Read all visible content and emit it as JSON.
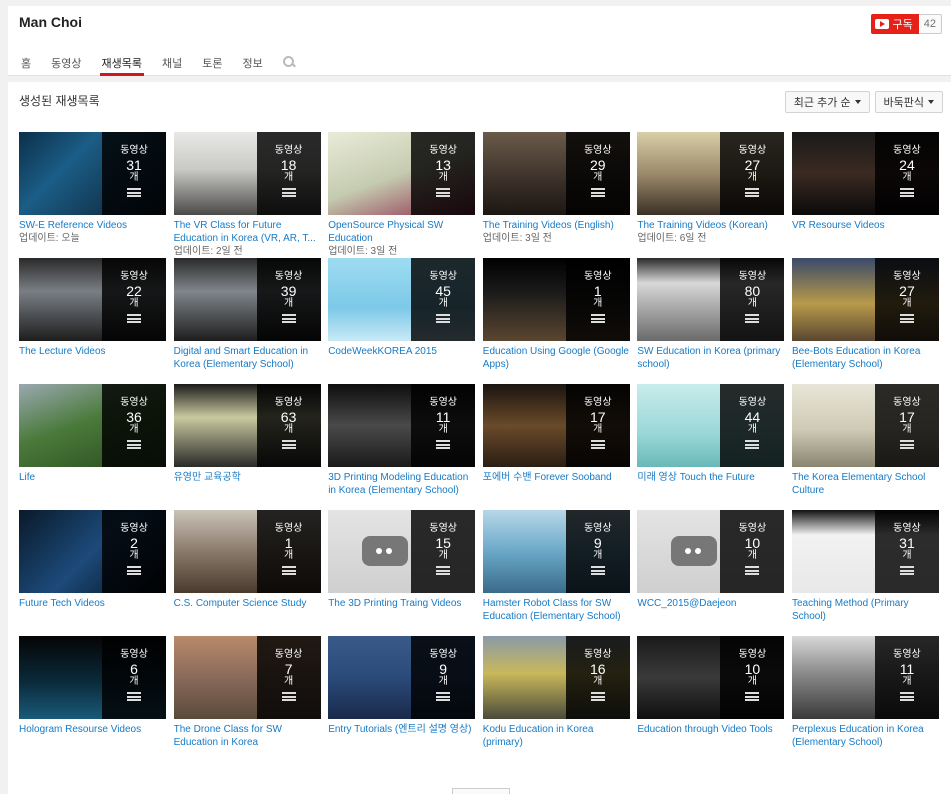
{
  "channel": {
    "name": "Man Choi",
    "subscribe_label": "구독",
    "subscriber_count": "42"
  },
  "tabs": [
    {
      "label": "홈",
      "active": false
    },
    {
      "label": "동영상",
      "active": false
    },
    {
      "label": "재생목록",
      "active": true
    },
    {
      "label": "채널",
      "active": false
    },
    {
      "label": "토론",
      "active": false
    },
    {
      "label": "정보",
      "active": false
    }
  ],
  "section": {
    "title": "생성된 재생목록",
    "sort_label": "최근 추가 순",
    "view_label": "바둑판식"
  },
  "overlay": {
    "label": "동영상",
    "unit": "개"
  },
  "playlists": [
    {
      "title": "SW-E Reference Videos",
      "meta": "업데이트: 오늘",
      "count": "31",
      "bg": "linear-gradient(135deg,#0c2f4a 0%,#1b5d86 35%,#0b1a2a 100%)"
    },
    {
      "title": "The VR Class for Future Education in Korea (VR, AR, T...",
      "meta": "업데이트: 2일 전",
      "count": "18",
      "bg": "linear-gradient(180deg,#e8e8e6 0%,#c9c9c6 45%,#4b4a48 100%)"
    },
    {
      "title": "OpenSource Physical SW Education",
      "meta": "업데이트: 3일 전",
      "count": "13",
      "bg": "linear-gradient(160deg,#e9ecd8 0%,#c5cbb0 50%,#8c2a4a 100%)"
    },
    {
      "title": "The Training Videos (English)",
      "meta": "업데이트: 3일 전",
      "count": "29",
      "bg": "linear-gradient(180deg,#6a5b4a 0%,#3a2f28 60%,#1c1612 100%)"
    },
    {
      "title": "The Training Videos (Korean)",
      "meta": "업데이트: 6일 전",
      "count": "27",
      "bg": "linear-gradient(180deg,#d8cfa8 0%,#9c8a6a 50%,#3a3026 100%)"
    },
    {
      "title": "VR Resourse Videos",
      "meta": "",
      "count": "24",
      "bg": "linear-gradient(180deg,#1a1a1a 0%,#3b2a22 50%,#0a0a0a 100%)"
    },
    {
      "title": "The Lecture Videos",
      "meta": "",
      "count": "22",
      "bg": "linear-gradient(180deg,#2a2a2a 0%,#7a7f85 40%,#1d1d1d 100%)"
    },
    {
      "title": "Digital and Smart Education in Korea (Elementary School)",
      "meta": "",
      "count": "39",
      "bg": "linear-gradient(180deg,#2a2a2a 0%,#80868b 40%,#1d1d1d 100%)"
    },
    {
      "title": "CodeWeekKOREA 2015",
      "meta": "",
      "count": "45",
      "bg": "linear-gradient(180deg,#9fdcf2 0%,#7cc9e8 60%,#c9e9f5 100%)"
    },
    {
      "title": "Education Using Google (Google Apps)",
      "meta": "",
      "count": "1",
      "bg": "linear-gradient(180deg,#000 0%,#1a1a1a 40%,#5a4630 100%)"
    },
    {
      "title": "SW Education in Korea (primary school)",
      "meta": "",
      "count": "80",
      "bg": "linear-gradient(180deg,#2a2a2a 0%,#d8d8d8 30%,#6a6a6a 100%)"
    },
    {
      "title": "Bee-Bots Education in Korea (Elementary School)",
      "meta": "",
      "count": "27",
      "bg": "linear-gradient(180deg,#3a4a6a 0%,#b89a4a 55%,#5a4630 100%)"
    },
    {
      "title": "Life",
      "meta": "",
      "count": "36",
      "bg": "linear-gradient(160deg,#9aa8b0 0%,#4a7a3a 45%,#2a4a1e 100%)"
    },
    {
      "title": "유영만 교육공학",
      "meta": "",
      "count": "63",
      "bg": "linear-gradient(180deg,#1a1a1a 0%,#c9c9a0 40%,#2a2a2a 100%)"
    },
    {
      "title": "3D Printing Modeling Education in Korea (Elementary School)",
      "meta": "",
      "count": "11",
      "bg": "linear-gradient(180deg,#0d0d0d 0%,#4a4a4a 50%,#1a1a1a 100%)"
    },
    {
      "title": "포에버 수밴 Forever Sooband",
      "meta": "",
      "count": "17",
      "bg": "linear-gradient(180deg,#1a1410 0%,#6a4a2a 50%,#2a1e14 100%)"
    },
    {
      "title": "미래 영상 Touch the Future",
      "meta": "",
      "count": "44",
      "bg": "linear-gradient(180deg,#c9ecec 0%,#9ad7d7 60%,#6ab8b8 100%)"
    },
    {
      "title": "The Korea Elementary School Culture",
      "meta": "",
      "count": "17",
      "bg": "linear-gradient(180deg,#e8e6d8 0%,#cfcab5 55%,#8a8570 100%)"
    },
    {
      "title": "Future Tech Videos",
      "meta": "",
      "count": "2",
      "bg": "linear-gradient(135deg,#0a1a2a 0%,#1c4a7a 50%,#050b14 100%)"
    },
    {
      "title": "C.S. Computer Science Study",
      "meta": "",
      "count": "1",
      "bg": "linear-gradient(180deg,#c9c3b8 0%,#8a7a6a 50%,#4a3a2e 100%)"
    },
    {
      "title": "The 3D Printing Traing Videos",
      "meta": "",
      "count": "15",
      "bg": "linear-gradient(180deg,#e4e4e4 0%,#cfcfcf 100%)",
      "placeholder": true
    },
    {
      "title": "Hamster Robot Class for SW Education (Elementary School)",
      "meta": "",
      "count": "9",
      "bg": "linear-gradient(180deg,#b7d7e8 0%,#6aa8c8 50%,#3a6a8a 100%)"
    },
    {
      "title": "WCC_2015@Daejeon",
      "meta": "",
      "count": "10",
      "bg": "linear-gradient(180deg,#e4e4e4 0%,#cfcfcf 100%)",
      "placeholder": true
    },
    {
      "title": "Teaching Method (Primary School)",
      "meta": "",
      "count": "31",
      "bg": "linear-gradient(180deg,#111 0%,#f2f2f2 30%,#e8e8e8 100%)"
    },
    {
      "title": "Hologram Resourse Videos",
      "meta": "",
      "count": "6",
      "bg": "linear-gradient(180deg,#050505 0%,#0a2a3a 55%,#1a5a7a 100%)"
    },
    {
      "title": "The Drone Class for SW Education in Korea",
      "meta": "",
      "count": "7",
      "bg": "linear-gradient(180deg,#b88a6a 0%,#8a6a5a 50%,#5a4a3a 100%)"
    },
    {
      "title": "Entry Tutorials (엔트리 설명 영상)",
      "meta": "",
      "count": "9",
      "bg": "linear-gradient(180deg,#3a5a8a 0%,#2a4a7a 50%,#1a2a4a 100%)"
    },
    {
      "title": "Kodu Education in Korea (primary)",
      "meta": "",
      "count": "16",
      "bg": "linear-gradient(180deg,#8a9aa8 0%,#c9b85a 45%,#4a4a3a 100%)"
    },
    {
      "title": "Education through Video Tools",
      "meta": "",
      "count": "10",
      "bg": "linear-gradient(180deg,#1a1a1a 0%,#3a3a3a 50%,#0f0f0f 100%)"
    },
    {
      "title": "Perplexus Education in Korea (Elementary School)",
      "meta": "",
      "count": "11",
      "bg": "linear-gradient(180deg,#d8d8d8 0%,#8a8a8a 45%,#3a3a3a 100%)"
    }
  ]
}
